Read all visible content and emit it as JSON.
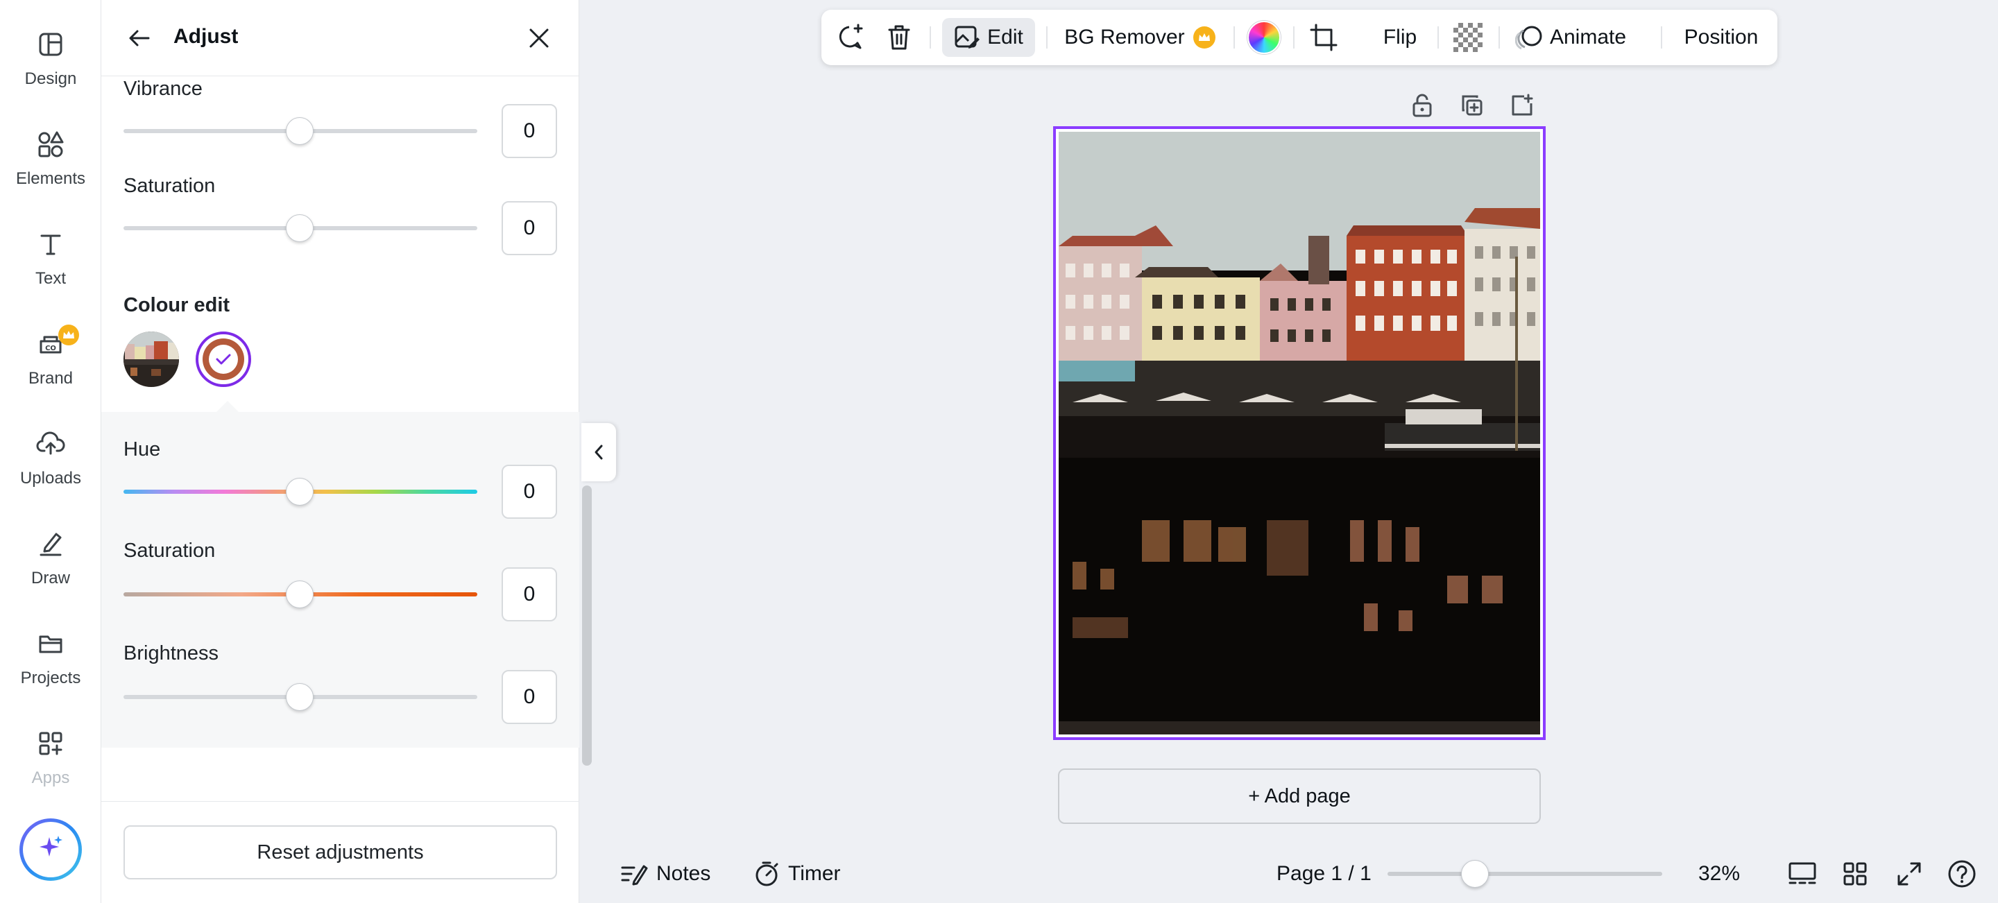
{
  "rail": {
    "items": [
      {
        "label": "Design",
        "icon": "design-icon"
      },
      {
        "label": "Elements",
        "icon": "elements-icon"
      },
      {
        "label": "Text",
        "icon": "text-icon"
      },
      {
        "label": "Brand",
        "icon": "brand-icon"
      },
      {
        "label": "Uploads",
        "icon": "uploads-icon"
      },
      {
        "label": "Draw",
        "icon": "draw-icon"
      },
      {
        "label": "Projects",
        "icon": "projects-icon"
      },
      {
        "label": "Apps",
        "icon": "apps-icon"
      }
    ]
  },
  "panel": {
    "title": "Adjust",
    "vibrance": {
      "label": "Vibrance",
      "value": "0"
    },
    "saturation": {
      "label": "Saturation",
      "value": "0"
    },
    "colour_edit": {
      "label": "Colour edit"
    },
    "hue": {
      "label": "Hue",
      "value": "0"
    },
    "colour_saturation": {
      "label": "Saturation",
      "value": "0"
    },
    "brightness": {
      "label": "Brightness",
      "value": "0"
    },
    "reset_label": "Reset adjustments"
  },
  "toolbar": {
    "edit_label": "Edit",
    "bg_remover_label": "BG Remover",
    "flip_label": "Flip",
    "animate_label": "Animate",
    "position_label": "Position"
  },
  "canvas": {
    "add_page_label": "+ Add page"
  },
  "bottom": {
    "notes_label": "Notes",
    "timer_label": "Timer",
    "page_indicator": "Page 1 / 1",
    "zoom_level": "32%"
  },
  "colors": {
    "accent": "#8b3dff",
    "selected_swatch": "#b45a3a",
    "premium_crown": "#f7b21a"
  }
}
